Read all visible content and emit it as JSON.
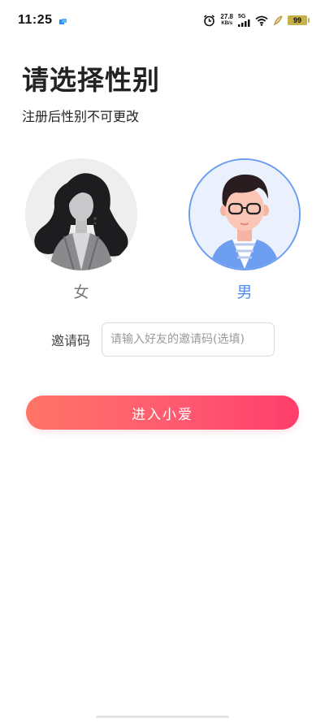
{
  "status_bar": {
    "time": "11:25",
    "net_speed_value": "27.8",
    "net_speed_unit": "KB/s",
    "network": "5G",
    "battery": "99",
    "icons": [
      "app-notification-icon",
      "alarm-icon",
      "signal-icon",
      "wifi-icon",
      "feather-icon",
      "battery-icon"
    ]
  },
  "page": {
    "title": "请选择性别",
    "subtitle": "注册后性别不可更改"
  },
  "genders": {
    "female": {
      "label": "女",
      "selected": false
    },
    "male": {
      "label": "男",
      "selected": true
    }
  },
  "invite": {
    "label": "邀请码",
    "placeholder": "请输入好友的邀请码(选填)",
    "value": ""
  },
  "actions": {
    "enter_label": "进入小爱"
  },
  "colors": {
    "accent_blue": "#4f8cf0",
    "button_gradient_start": "#ff7566",
    "button_gradient_end": "#ff3e6c"
  }
}
